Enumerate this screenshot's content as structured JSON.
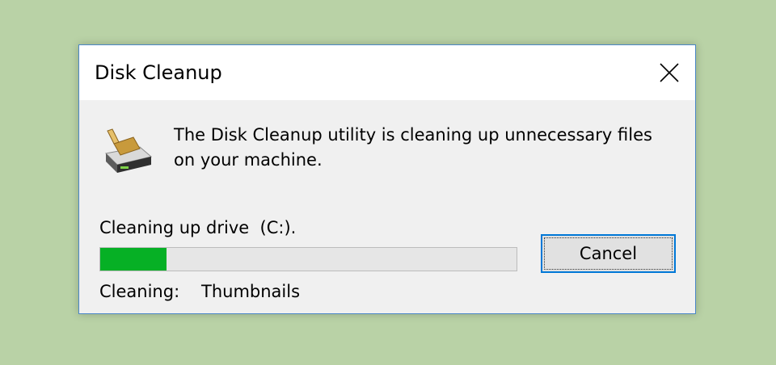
{
  "window": {
    "title": "Disk Cleanup",
    "close_icon": "close-icon"
  },
  "app_icon": "disk-cleanup-brush-drive-icon",
  "message": "The Disk Cleanup utility is cleaning up unnecessary files on your machine.",
  "progress": {
    "label": "Cleaning up drive  (C:).",
    "fraction": 0.16,
    "fill_color": "#06b025"
  },
  "status": {
    "label": "Cleaning:",
    "value": "Thumbnails"
  },
  "buttons": {
    "cancel": "Cancel"
  },
  "colors": {
    "background": "#b9d2a6",
    "window_border": "#4a86c7",
    "focus_border": "#0078d7"
  }
}
